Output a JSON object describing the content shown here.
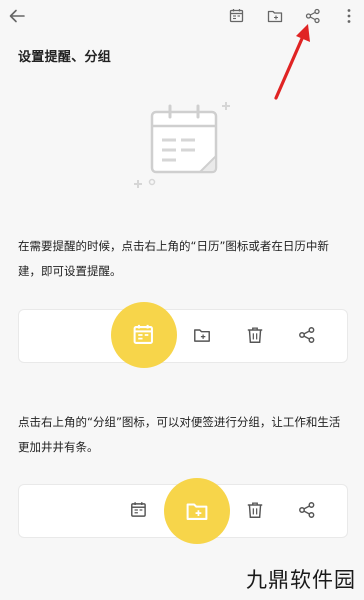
{
  "toolbar": {
    "back_icon": "arrow-left-icon",
    "calendar_icon": "calendar-icon",
    "folder_icon": "folder-icon",
    "share_icon": "share-icon",
    "more_icon": "more-vertical-icon"
  },
  "section_title": "设置提醒、分组",
  "paragraph1": "在需要提醒的时候，点击右上角的“日历”图标或者在日历中新建，即可设置提醒。",
  "paragraph2": "点击右上角的“分组”图标，可以对便签进行分组，让工作和生活更加井井有条。",
  "card1": {
    "highlighted": "calendar-icon",
    "icons": [
      "calendar-icon",
      "folder-icon",
      "trash-icon",
      "share-icon"
    ]
  },
  "card2": {
    "highlighted": "folder-icon",
    "icons": [
      "calendar-icon",
      "folder-icon",
      "trash-icon",
      "share-icon"
    ]
  },
  "colors": {
    "accent": "#f7d54a",
    "annotation_arrow": "#e02424",
    "background": "#f7f7f7"
  },
  "watermark": "九鼎软件园"
}
